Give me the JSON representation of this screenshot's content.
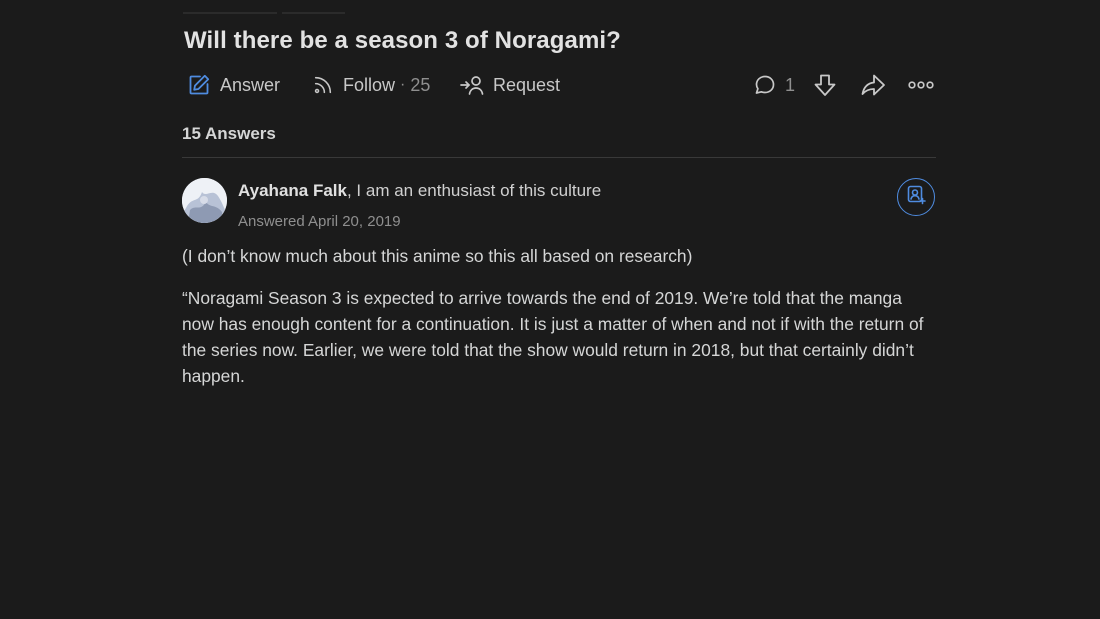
{
  "question": {
    "title": "Will there be a season 3 of Noragami?"
  },
  "actions": {
    "answer_label": "Answer",
    "follow_label": "Follow",
    "follow_separator": "·",
    "follow_count": "25",
    "request_label": "Request",
    "comment_count": "1"
  },
  "icons": {
    "answer": "pencil-edit-icon",
    "follow": "rss-follow-icon",
    "request": "request-person-icon",
    "comment": "comment-bubble-icon",
    "downvote": "downvote-arrow-icon",
    "share": "share-arrow-icon",
    "more": "more-options-icon",
    "follow_user": "follow-user-icon"
  },
  "answers_header": {
    "count_label": "15 Answers"
  },
  "answer": {
    "author_name": "Ayahana Falk",
    "author_credential": ", I am an enthusiast of this culture",
    "answered_date": "Answered April 20, 2019",
    "paragraphs": [
      "(I don’t know much about this anime so this all based on research)",
      "“Noragami Season 3 is expected to arrive towards the end of 2019. We’re told that the manga now has enough content for a continuation. It is just a matter of when and not if with the return of the series now. Earlier, we were told that the show would return in 2018, but that certainly didn’t happen."
    ]
  },
  "colors": {
    "background": "#1b1b1b",
    "accent_blue": "#4f8ce0",
    "text_primary": "#d5d6d6",
    "text_muted": "#8f8f8f"
  }
}
